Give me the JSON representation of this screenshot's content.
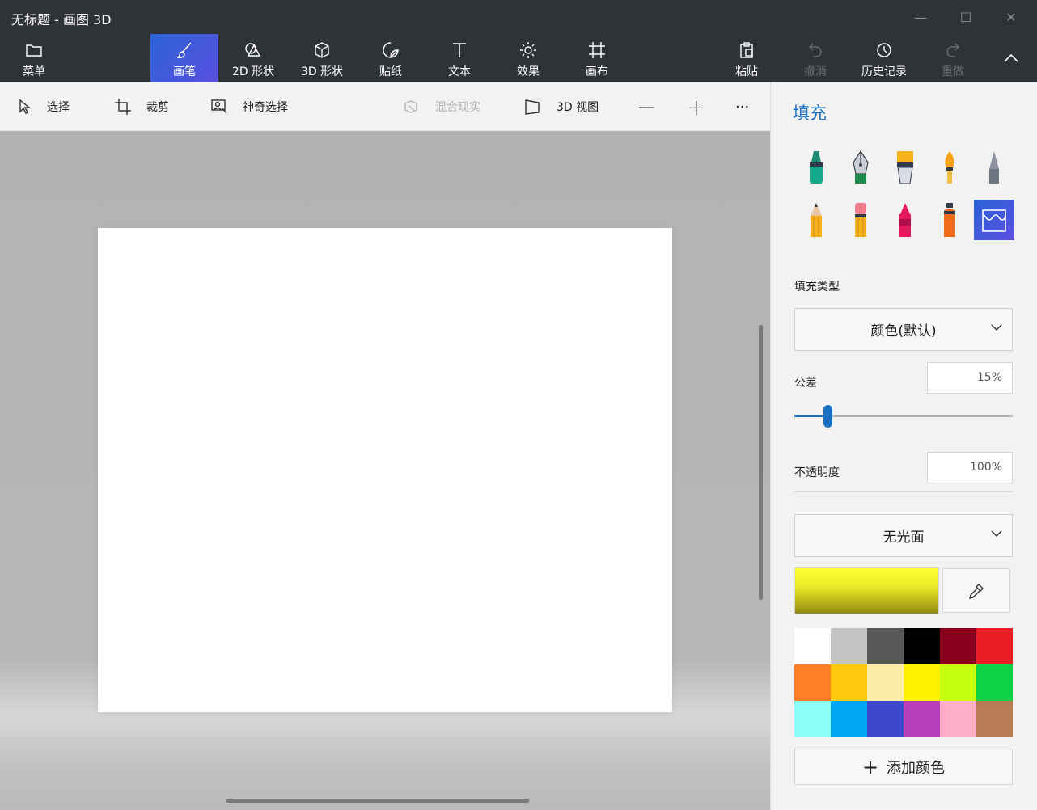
{
  "app": {
    "title": "无标题 - 画图 3D"
  },
  "window_controls": {
    "minimize": "—",
    "maximize": "☐",
    "close": "✕"
  },
  "ribbon": {
    "menu": "菜单",
    "tools": [
      {
        "label": "画笔",
        "icon": "brush-icon",
        "active": true
      },
      {
        "label": "2D 形状",
        "icon": "2d-shapes-icon"
      },
      {
        "label": "3D 形状",
        "icon": "3d-shapes-icon"
      },
      {
        "label": "贴纸",
        "icon": "sticker-icon"
      },
      {
        "label": "文本",
        "icon": "text-icon"
      },
      {
        "label": "效果",
        "icon": "effects-icon"
      },
      {
        "label": "画布",
        "icon": "canvas-icon"
      }
    ],
    "paste": "粘贴",
    "undo": "撤消",
    "history": "历史记录",
    "redo": "重做"
  },
  "toolbar": {
    "select": "选择",
    "crop": "裁剪",
    "magic_select": "神奇选择",
    "mixed_reality": "混合现实",
    "view_3d": "3D 视图",
    "zoom_out": "—",
    "zoom_in": "+",
    "more": "···"
  },
  "panel": {
    "title": "填充",
    "brushes": [
      "marker",
      "calligraphy-pen",
      "oil-brush",
      "watercolor",
      "pixel-pen",
      "pencil",
      "eraser",
      "crayon",
      "spray-can",
      "fill"
    ],
    "selected_brush": "fill",
    "fill_type_label": "填充类型",
    "fill_type_value": "颜色(默认)",
    "tolerance_label": "公差",
    "tolerance_value": "15%",
    "tolerance_level": 0.15,
    "opacity_label": "不透明度",
    "opacity_value": "100%",
    "finish_value": "无光面",
    "current_color": "#ffff33",
    "palette": [
      "#ffffff",
      "#c3c3c3",
      "#585858",
      "#000000",
      "#88001b",
      "#ec1c24",
      "#ff7f27",
      "#ffc90e",
      "#fdeca6",
      "#fff200",
      "#c4ff0e",
      "#0ed145",
      "#8cfffb",
      "#00a8f3",
      "#3f48cc",
      "#b83dba",
      "#ffaec8",
      "#b97a56"
    ],
    "add_color": "添加颜色"
  }
}
